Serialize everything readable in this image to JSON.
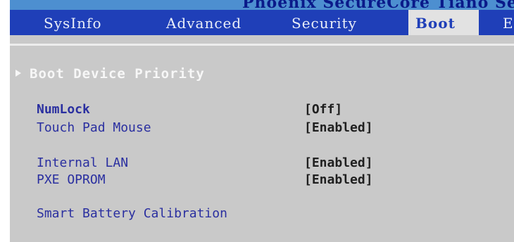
{
  "window": {
    "title": "Phoenix SecureCore Tiano Set"
  },
  "tabs": [
    {
      "label": "SysInfo",
      "active": false
    },
    {
      "label": "Advanced",
      "active": false
    },
    {
      "label": "Security",
      "active": false
    },
    {
      "label": "Boot",
      "active": true
    },
    {
      "label": "E",
      "active": false
    }
  ],
  "boot_menu": {
    "submenu": {
      "label": "Boot Device Priority",
      "icon": "triangle-right-icon"
    },
    "settings": [
      {
        "label": "NumLock",
        "value": "[Off]"
      },
      {
        "label": "Touch Pad Mouse",
        "value": "[Enabled]"
      },
      {
        "label": "Internal LAN",
        "value": "[Enabled]"
      },
      {
        "label": "PXE OPROM",
        "value": "[Enabled]"
      }
    ],
    "action": {
      "label": "Smart Battery Calibration"
    }
  },
  "colors": {
    "menu_bar": "#1f3fb8",
    "title_bar": "#4d8fd0",
    "background": "#c9c9c9",
    "item_text": "#2a2fa0",
    "value_text": "#1f1f1f",
    "submenu_text": "#f7f7f7"
  }
}
